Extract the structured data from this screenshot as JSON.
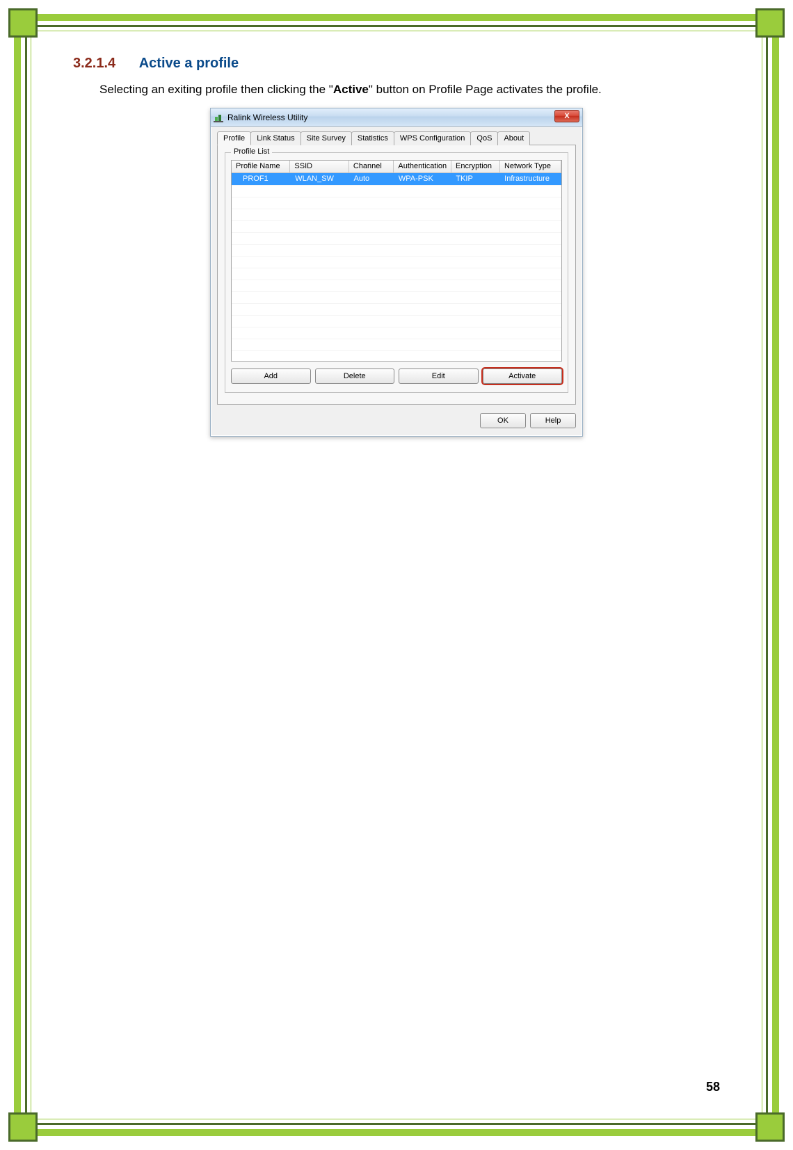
{
  "doc": {
    "heading_number": "3.2.1.4",
    "heading_title": "Active a profile",
    "body_pre": "Selecting an exiting profile then clicking the \"",
    "body_bold": "Active",
    "body_post": "\" button on Profile Page activates the profile.",
    "page_number": "58"
  },
  "window": {
    "title": "Ralink Wireless Utility",
    "close_label": "X",
    "tabs": [
      "Profile",
      "Link Status",
      "Site Survey",
      "Statistics",
      "WPS Configuration",
      "QoS",
      "About"
    ],
    "active_tab_index": 0,
    "fieldset_legend": "Profile List",
    "columns": [
      "Profile Name",
      "SSID",
      "Channel",
      "Authentication",
      "Encryption",
      "Network Type"
    ],
    "rows": [
      {
        "name": "PROF1",
        "ssid": "WLAN_SW",
        "channel": "Auto",
        "auth": "WPA-PSK",
        "enc": "TKIP",
        "net": "Infrastructure",
        "selected": true
      }
    ],
    "buttons": {
      "add": "Add",
      "delete": "Delete",
      "edit": "Edit",
      "activate": "Activate"
    },
    "footer": {
      "ok": "OK",
      "help": "Help"
    }
  }
}
